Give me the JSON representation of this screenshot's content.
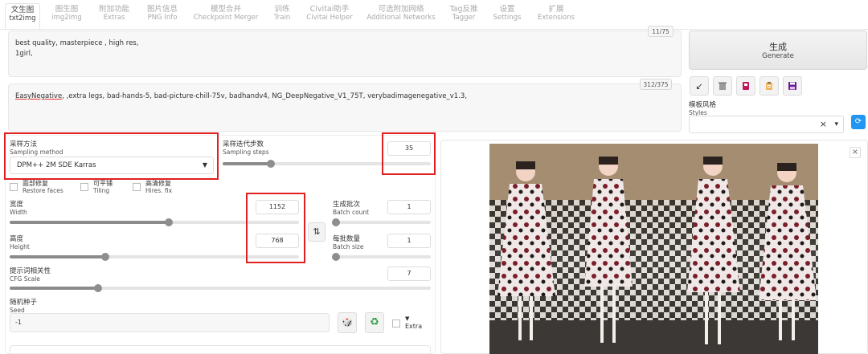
{
  "tabs": [
    {
      "cn": "文生图",
      "en": "txt2img"
    },
    {
      "cn": "图生图",
      "en": "img2img"
    },
    {
      "cn": "附加功能",
      "en": "Extras"
    },
    {
      "cn": "图片信息",
      "en": "PNG Info"
    },
    {
      "cn": "模型合并",
      "en": "Checkpoint Merger"
    },
    {
      "cn": "训练",
      "en": "Train"
    },
    {
      "cn": "Civitai助手",
      "en": "Civitai Helper"
    },
    {
      "cn": "可选附加网络",
      "en": "Additional Networks"
    },
    {
      "cn": "Tag反推",
      "en": "Tagger"
    },
    {
      "cn": "设置",
      "en": "Settings"
    },
    {
      "cn": "扩展",
      "en": "Extensions"
    }
  ],
  "prompt": {
    "text": "best quality, masterpiece , high res,\n1girl,",
    "counter": "11/75"
  },
  "negative_prompt": {
    "underlined": "EasyNegative",
    "rest": ", ,extra legs, bad-hands-5, bad-picture-chill-75v, badhandv4, NG_DeepNegative_V1_75T, verybadimagenegative_v1.3,",
    "counter": "312/375"
  },
  "generate": {
    "cn": "生成",
    "en": "Generate"
  },
  "tool_buttons": {
    "arrow": "↙",
    "trash": "🗑",
    "style_card": "■",
    "clipboard": "📋",
    "save": "💾"
  },
  "styles": {
    "cn": "模板风格",
    "en": "Styles",
    "clear": "×",
    "dropdown": "▾",
    "refresh": "⟳"
  },
  "sampling_method": {
    "cn": "采样方法",
    "en": "Sampling method",
    "value": "DPM++ 2M SDE Karras"
  },
  "sampling_steps": {
    "cn": "采样迭代步数",
    "en": "Sampling steps",
    "value": "35",
    "fraction": 0.23
  },
  "restore_faces": {
    "cn": "面部修复",
    "en": "Restore faces"
  },
  "tiling": {
    "cn": "可平铺",
    "en": "Tiling"
  },
  "hires_fix": {
    "cn": "高清修复",
    "en": "Hires. fix"
  },
  "width": {
    "cn": "宽度",
    "en": "Width",
    "value": "1152",
    "fraction": 0.55
  },
  "height": {
    "cn": "高度",
    "en": "Height",
    "value": "768",
    "fraction": 0.33
  },
  "swap_icon": "⇅",
  "batch_count": {
    "cn": "生成批次",
    "en": "Batch count",
    "value": "1",
    "fraction": 0.0
  },
  "batch_size": {
    "cn": "每批数量",
    "en": "Batch size",
    "value": "1",
    "fraction": 0.0
  },
  "cfg_scale": {
    "cn": "提示词相关性",
    "en": "CFG Scale",
    "value": "7",
    "fraction": 0.21
  },
  "seed": {
    "cn": "随机种子",
    "en": "Seed",
    "value": "-1",
    "dice": "🎲",
    "recycle": "♻",
    "extra_arrow": "▼",
    "extra": "Extra"
  },
  "close_icon": "×",
  "colors": {
    "red_highlight": "#e02020",
    "accent": "#8e8e8e"
  }
}
